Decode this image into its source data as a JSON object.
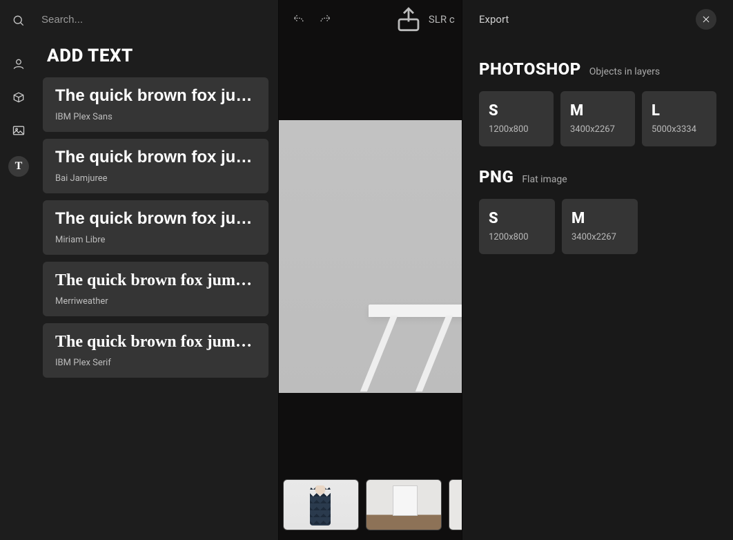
{
  "search": {
    "placeholder": "Search..."
  },
  "left_panel": {
    "title": "ADD TEXT",
    "fonts": [
      {
        "sample": "The quick brown fox jumped over the lazy dog",
        "name": "IBM Plex Sans"
      },
      {
        "sample": "The quick brown fox jumped over the lazy dog",
        "name": "Bai Jamjuree"
      },
      {
        "sample": "The quick brown fox jumped over the lazy dog",
        "name": "Miriam Libre"
      },
      {
        "sample": "The quick brown fox jumped over the lazy dog",
        "name": "Merriweather"
      },
      {
        "sample": "The quick brown fox jumped over the lazy dog",
        "name": "IBM Plex Serif"
      }
    ]
  },
  "center": {
    "share_label": "SLR camera"
  },
  "export": {
    "title": "Export",
    "photoshop": {
      "heading": "PHOTOSHOP",
      "sub": "Objects in layers",
      "tiles": [
        {
          "size": "S",
          "dim": "1200x800"
        },
        {
          "size": "M",
          "dim": "3400x2267"
        },
        {
          "size": "L",
          "dim": "5000x3334"
        }
      ]
    },
    "png": {
      "heading": "PNG",
      "sub": "Flat image",
      "tiles": [
        {
          "size": "S",
          "dim": "1200x800"
        },
        {
          "size": "M",
          "dim": "3400x2267"
        }
      ]
    }
  },
  "rail": {
    "text_button": "T"
  }
}
